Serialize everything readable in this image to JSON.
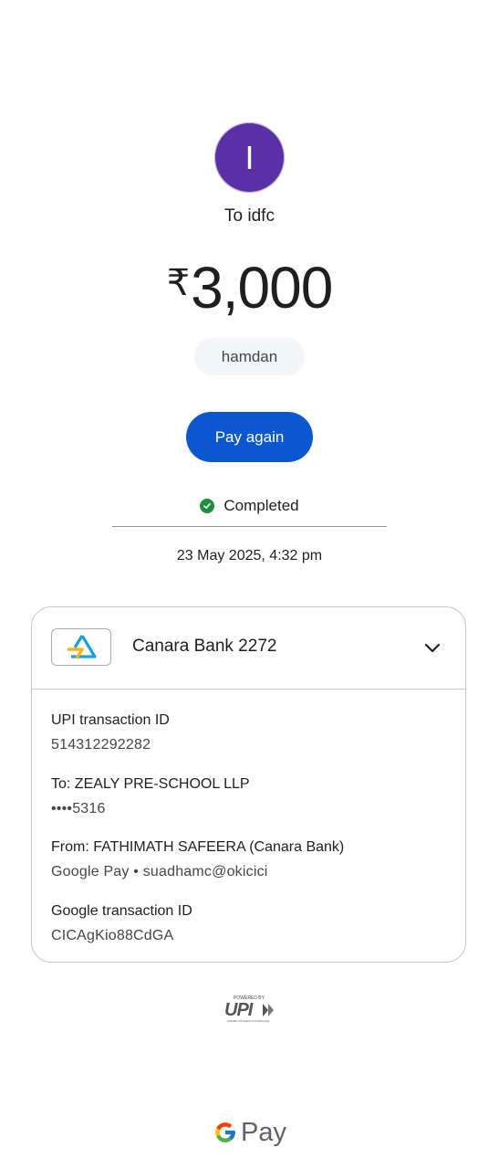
{
  "payee": {
    "avatar_letter": "I",
    "to_label": "To idfc"
  },
  "amount": {
    "currency_symbol": "₹",
    "value": "3,000"
  },
  "note": "hamdan",
  "actions": {
    "pay_again_label": "Pay again"
  },
  "status": {
    "label": "Completed",
    "color": "#1e8e3e"
  },
  "timestamp": "23 May 2025, 4:32 pm",
  "account_card": {
    "bank_name": "Canara Bank 2272",
    "details": [
      {
        "label": "UPI transaction ID",
        "value": "514312292282"
      },
      {
        "label": "To: ZEALY PRE-SCHOOL LLP",
        "value": "••••5316"
      },
      {
        "label": "From: FATHIMATH  SAFEERA (Canara Bank)",
        "value": "Google Pay • suadhamc@okicici"
      },
      {
        "label": "Google transaction ID",
        "value": "CICAgKio88CdGA"
      }
    ]
  },
  "footer": {
    "powered_by": "POWERED BY",
    "upi": "UPI",
    "upi_tagline": "UNIFIED PAYMENTS INTERFACE",
    "brand_pay": "Pay"
  },
  "colors": {
    "accent": "#0b57d0",
    "avatar": "#5b2fa6"
  }
}
